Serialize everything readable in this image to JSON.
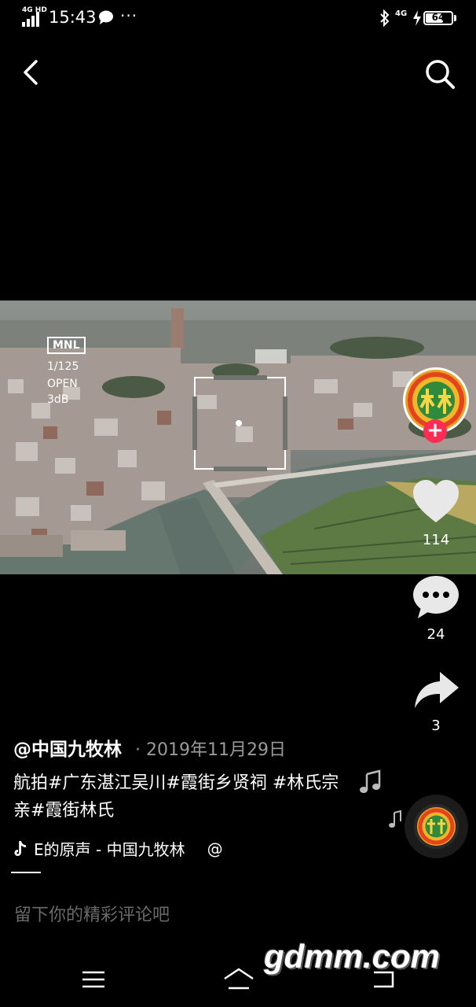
{
  "status_bar": {
    "network": "4G HD",
    "time": "15:43",
    "more": "···",
    "data_network": "4G",
    "battery": "64",
    "battery_level": 0.64
  },
  "video": {
    "hud_mode": "MNL",
    "hud_shutter": "1/125",
    "hud_aperture": "OPEN",
    "hud_gain": "3dB"
  },
  "actions": {
    "like_count": "114",
    "comment_count": "24",
    "share_count": "3"
  },
  "post": {
    "author": "@中国九牧林",
    "date": "· 2019年11月29日",
    "caption": "航拍#广东湛江吴川#霞街乡贤祠 #林氏宗亲#霞街林氏",
    "music": "E的原声 - 中国九牧林",
    "music_at": "@"
  },
  "comment": {
    "placeholder": "留下你的精彩评论吧"
  },
  "watermark": "gdmm.com",
  "colors": {
    "follow": "#fe2c55",
    "background": "#000000"
  }
}
